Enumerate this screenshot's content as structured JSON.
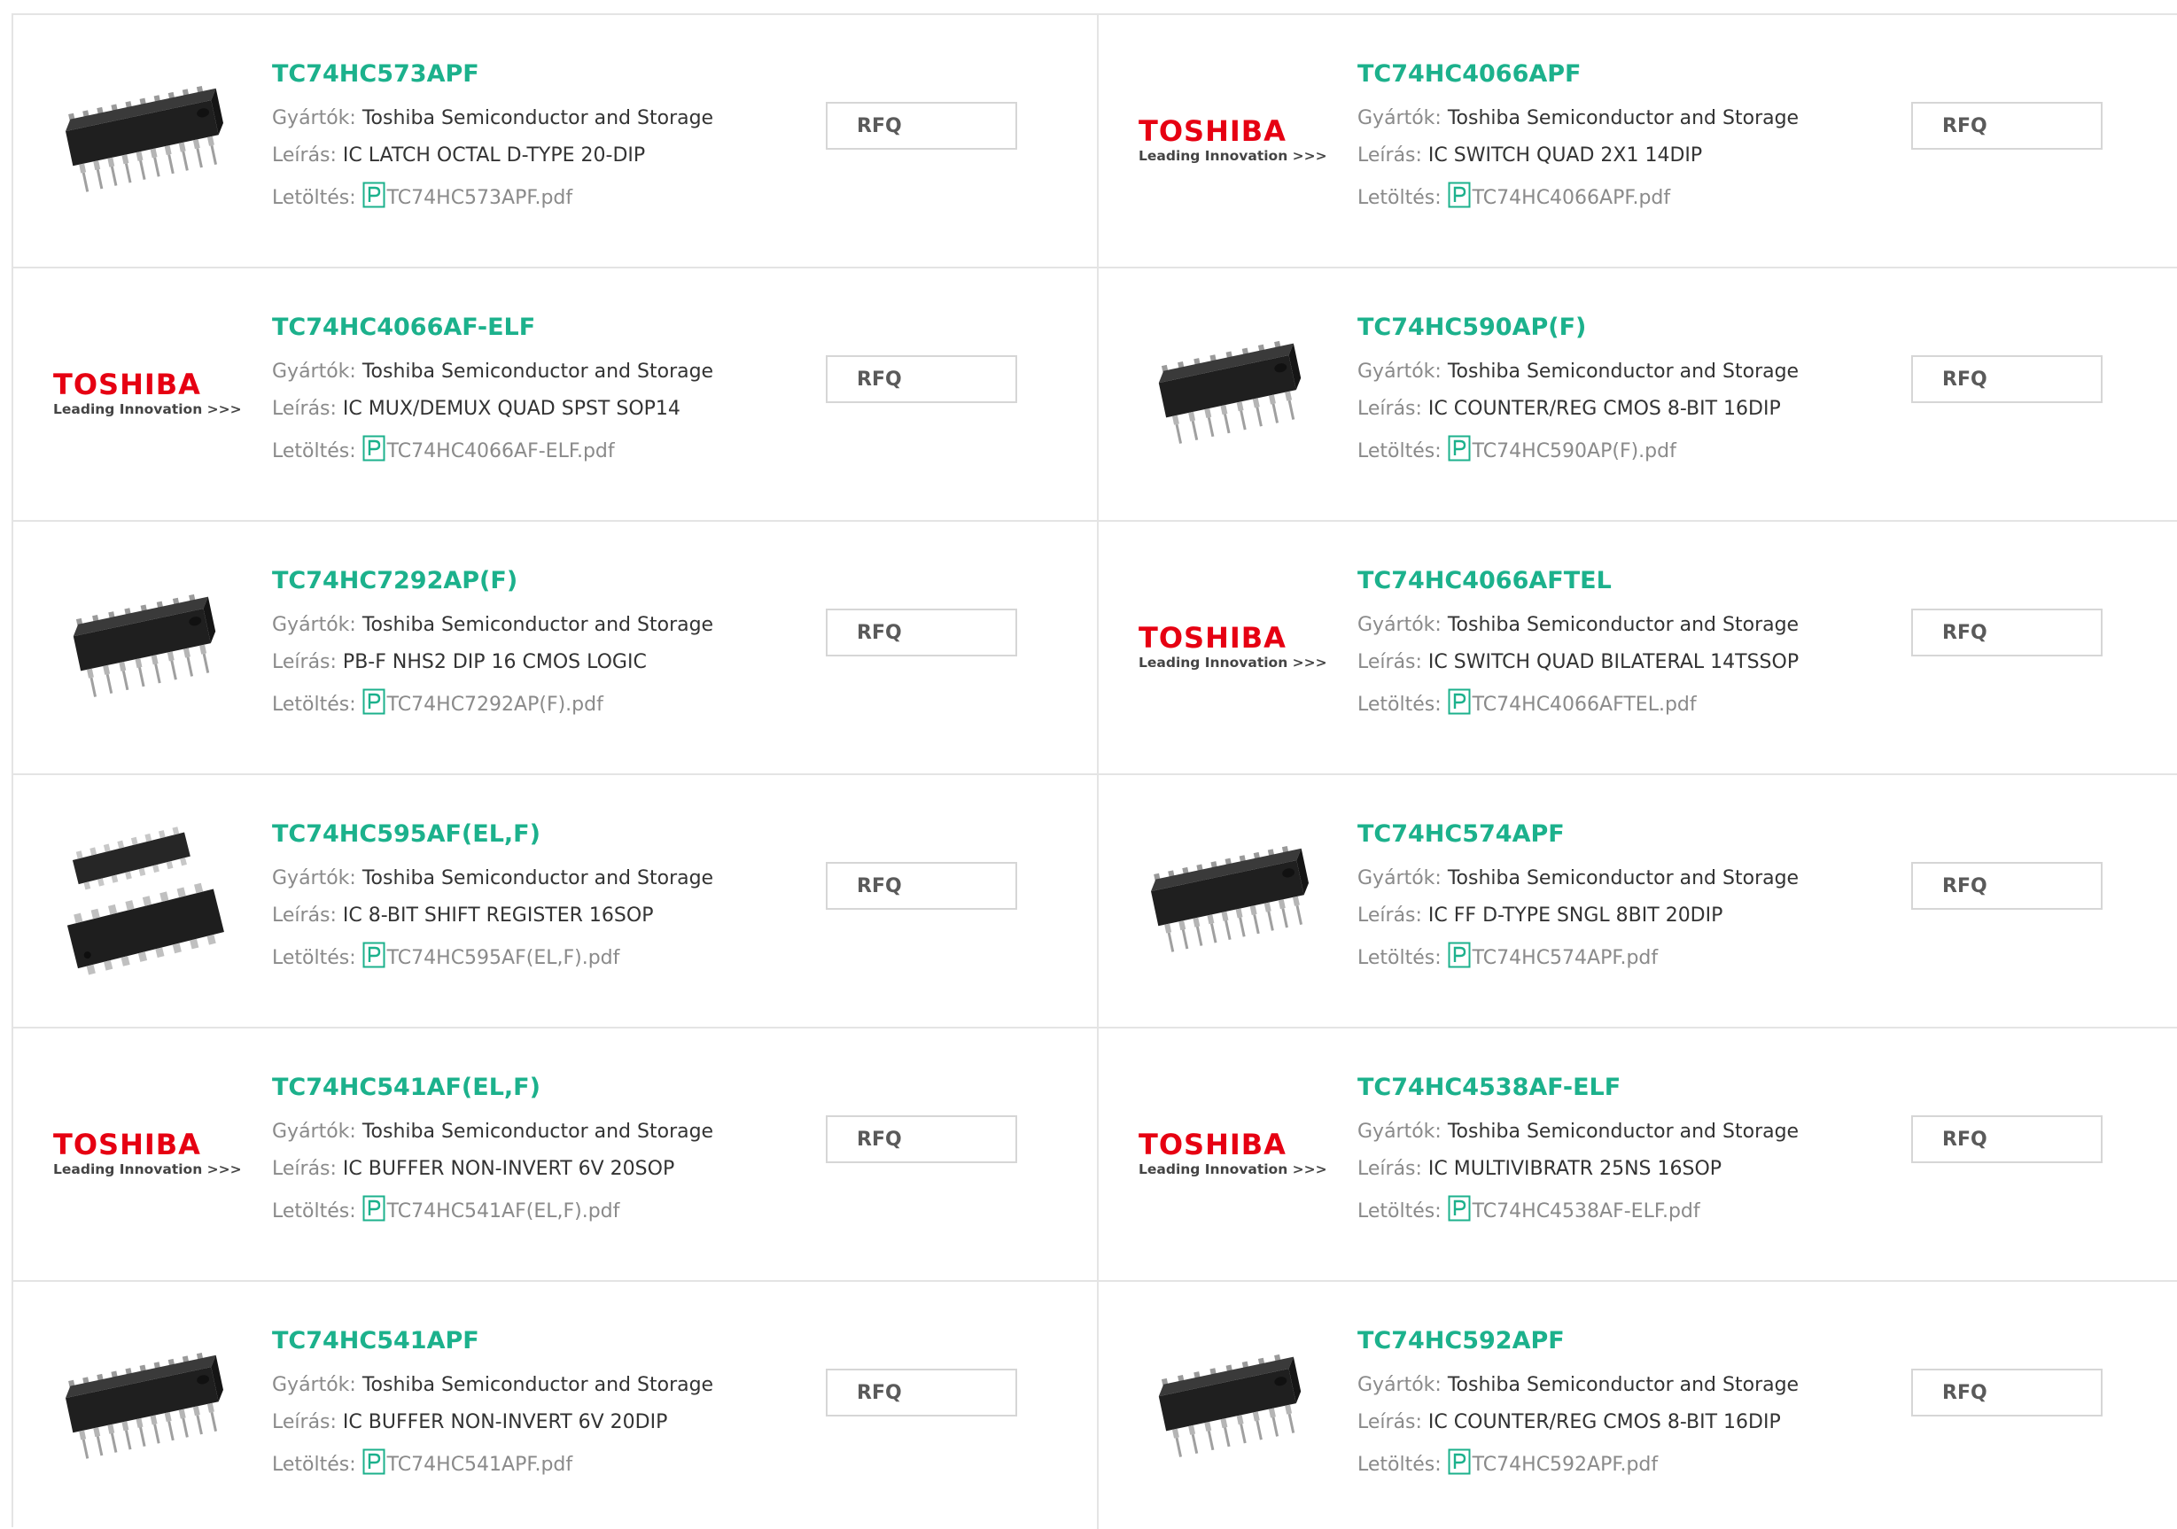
{
  "labels": {
    "manufacturer": "Gyártók:",
    "description": "Leírás:",
    "download": "Letöltés:",
    "rfq": "RFQ"
  },
  "logo": {
    "brand": "TOSHIBA",
    "tagline": "Leading Innovation >>>"
  },
  "colors": {
    "part_link": "#1cb18c",
    "brand_red": "#e60012",
    "pdf_icon": "#1cb18c",
    "border": "#e4e4e4"
  },
  "products": [
    {
      "part": "TC74HC573APF",
      "manufacturer": "Toshiba Semiconductor and Storage",
      "description": "IC LATCH OCTAL D-TYPE 20-DIP",
      "file": "TC74HC573APF.pdf",
      "image": "dip20-chip-icon"
    },
    {
      "part": "TC74HC4066APF",
      "manufacturer": "Toshiba Semiconductor and Storage",
      "description": "IC SWITCH QUAD 2X1 14DIP",
      "file": "TC74HC4066APF.pdf",
      "image": "toshiba-logo"
    },
    {
      "part": "TC74HC4066AF-ELF",
      "manufacturer": "Toshiba Semiconductor and Storage",
      "description": "IC MUX/DEMUX QUAD SPST SOP14",
      "file": "TC74HC4066AF-ELF.pdf",
      "image": "toshiba-logo"
    },
    {
      "part": "TC74HC590AP(F)",
      "manufacturer": "Toshiba Semiconductor and Storage",
      "description": "IC COUNTER/REG CMOS 8-BIT 16DIP",
      "file": "TC74HC590AP(F).pdf",
      "image": "dip16-chip-icon"
    },
    {
      "part": "TC74HC7292AP(F)",
      "manufacturer": "Toshiba Semiconductor and Storage",
      "description": "PB-F NHS2 DIP 16 CMOS LOGIC",
      "file": "TC74HC7292AP(F).pdf",
      "image": "dip16-chip-icon"
    },
    {
      "part": "TC74HC4066AFTEL",
      "manufacturer": "Toshiba Semiconductor and Storage",
      "description": "IC SWITCH QUAD BILATERAL 14TSSOP",
      "file": "TC74HC4066AFTEL.pdf",
      "image": "toshiba-logo"
    },
    {
      "part": "TC74HC595AF(EL,F)",
      "manufacturer": "Toshiba Semiconductor and Storage",
      "description": "IC 8-BIT SHIFT REGISTER 16SOP",
      "file": "TC74HC595AF(EL,F).pdf",
      "image": "sop-chips-icon"
    },
    {
      "part": "TC74HC574APF",
      "manufacturer": "Toshiba Semiconductor and Storage",
      "description": "IC FF D-TYPE SNGL 8BIT 20DIP",
      "file": "TC74HC574APF.pdf",
      "image": "dip20-chip-icon"
    },
    {
      "part": "TC74HC541AF(EL,F)",
      "manufacturer": "Toshiba Semiconductor and Storage",
      "description": "IC BUFFER NON-INVERT 6V 20SOP",
      "file": "TC74HC541AF(EL,F).pdf",
      "image": "toshiba-logo"
    },
    {
      "part": "TC74HC4538AF-ELF",
      "manufacturer": "Toshiba Semiconductor and Storage",
      "description": "IC MULTIVIBRATR 25NS 16SOP",
      "file": "TC74HC4538AF-ELF.pdf",
      "image": "toshiba-logo"
    },
    {
      "part": "TC74HC541APF",
      "manufacturer": "Toshiba Semiconductor and Storage",
      "description": "IC BUFFER NON-INVERT 6V 20DIP",
      "file": "TC74HC541APF.pdf",
      "image": "dip20-chip-icon"
    },
    {
      "part": "TC74HC592APF",
      "manufacturer": "Toshiba Semiconductor and Storage",
      "description": "IC COUNTER/REG CMOS 8-BIT 16DIP",
      "file": "TC74HC592APF.pdf",
      "image": "dip16-chip-icon"
    }
  ]
}
